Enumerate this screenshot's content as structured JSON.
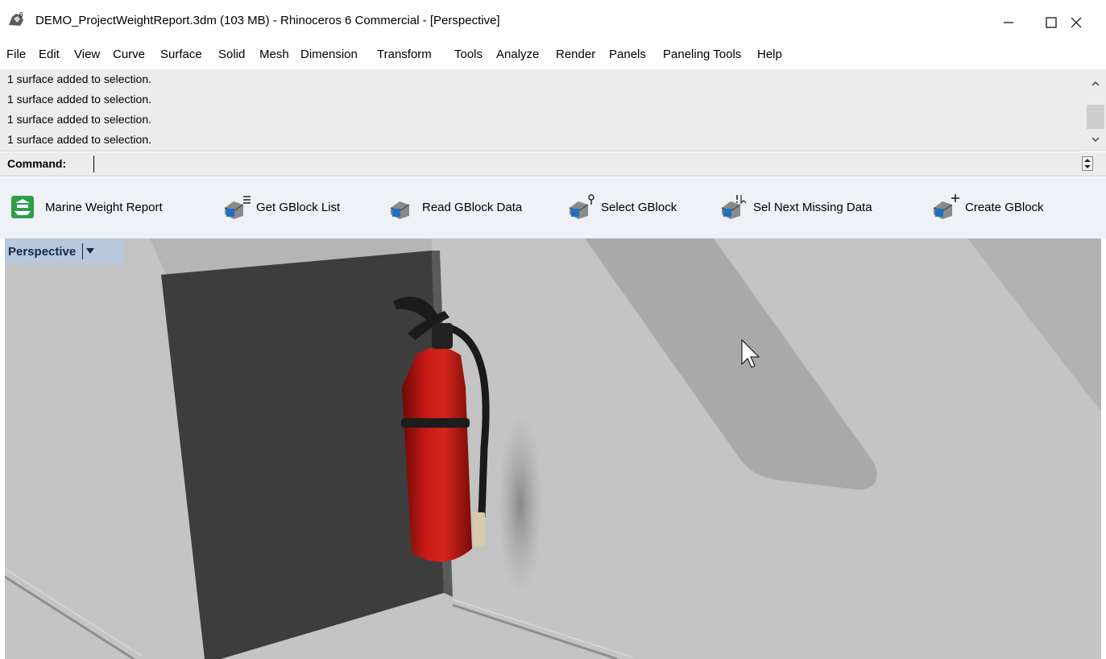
{
  "window": {
    "title": "DEMO_ProjectWeightReport.3dm (103 MB) - Rhinoceros 6 Commercial - [Perspective]",
    "minimize_symbol": "—",
    "maximize_symbol": "☐",
    "close_symbol": "✕"
  },
  "menu": {
    "items": [
      "File",
      "Edit",
      "View",
      "Curve",
      "Surface",
      "Solid",
      "Mesh",
      "Dimension",
      "Transform",
      "Tools",
      "Analyze",
      "Render",
      "Panels",
      "Paneling Tools",
      "Help"
    ]
  },
  "history": {
    "lines": [
      "1 surface added to selection.",
      "1 surface added to selection.",
      "1 surface added to selection.",
      "1 surface added to selection."
    ]
  },
  "command": {
    "label": "Command:",
    "value": ""
  },
  "toolbar": {
    "buttons": [
      {
        "label": "Marine Weight Report",
        "icon": "marine-weight-report-icon"
      },
      {
        "label": "Get GBlock List",
        "icon": "gblock-list-icon"
      },
      {
        "label": "Read GBlock Data",
        "icon": "gblock-read-icon"
      },
      {
        "label": "Select GBlock",
        "icon": "gblock-select-icon"
      },
      {
        "label": "Sel Next Missing Data",
        "icon": "gblock-next-missing-icon"
      },
      {
        "label": "Create GBlock",
        "icon": "gblock-create-icon"
      }
    ]
  },
  "viewport": {
    "name": "Perspective"
  },
  "colors": {
    "viewport_background": "#c2c2c2",
    "viewport_tab": "#b8c9dc",
    "extinguisher_red": "#b8140f",
    "bulkhead_dark": "#3f3f3f",
    "toolbar_background": "#eef1f5",
    "history_background": "#ececec"
  }
}
